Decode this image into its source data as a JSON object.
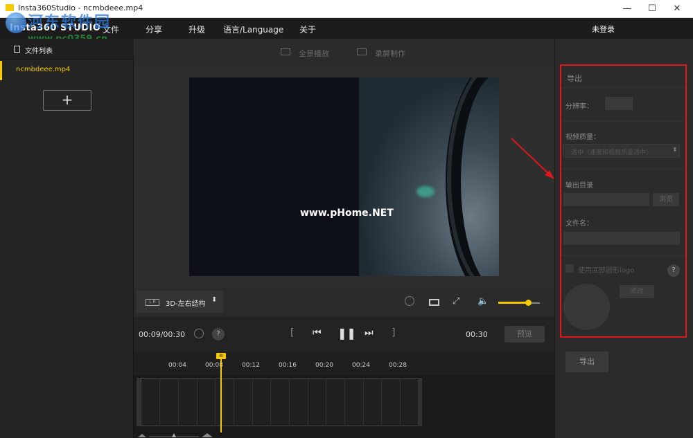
{
  "window": {
    "title": "Insta360Studio - ncmbdeee.mp4",
    "minimize": "—",
    "maximize": "☐",
    "close": "✕"
  },
  "watermark": {
    "text_cn": "河东软件园",
    "url": "www.pc0359.cn",
    "video_overlay": "www.pHome.NET"
  },
  "menubar": {
    "logo": "Insta360 STUDIO",
    "items": [
      "文件",
      "分享",
      "升级",
      "语言/Language",
      "关于"
    ],
    "login": "未登录"
  },
  "sidebar": {
    "header": "文件列表",
    "files": [
      "ncmbdeee.mp4"
    ],
    "add_label": "+"
  },
  "viewbar": {
    "panorama": "全景播放",
    "record": "录屏制作"
  },
  "controls": {
    "mode_label": "3D-左右结构",
    "mode_icon_text": "L R",
    "mode_arrow": "⬍",
    "volume_level": 0.72,
    "current_time": "00:09/00:30",
    "end_time": "00:30",
    "help": "?",
    "preview_btn": "预览",
    "bracket_left": "[",
    "bracket_right": "]"
  },
  "timeline": {
    "ticks": [
      "00:04",
      "00:08",
      "00:12",
      "00:16",
      "00:20",
      "00:24",
      "00:28"
    ],
    "playhead_label": "III"
  },
  "export_panel": {
    "title": "导出",
    "resolution_label": "分辨率：",
    "quality_label": "视频质量：",
    "quality_value": "适中（速度和视频质量适中）",
    "output_dir_label": "输出目录",
    "browse": "浏览",
    "filename_label": "文件名：",
    "logo_label": "使用底部圆形logo",
    "help": "?",
    "modify": "修改",
    "export_btn": "导出"
  },
  "colors": {
    "accent": "#f6c900",
    "annotation": "#e0161c"
  }
}
